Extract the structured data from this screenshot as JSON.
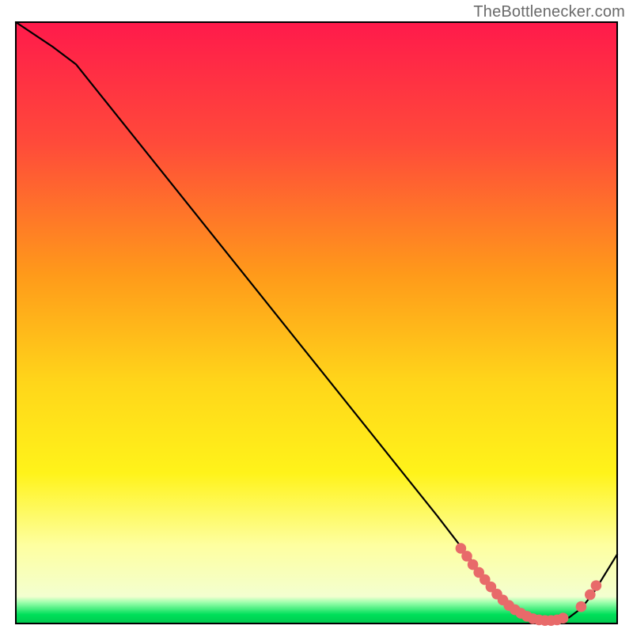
{
  "attribution": "TheBottlenecker.com",
  "chart_data": {
    "type": "line",
    "title": "",
    "xlabel": "",
    "ylabel": "",
    "xlim": [
      0,
      100
    ],
    "ylim": [
      0,
      100
    ],
    "background_gradient": {
      "top": "#ff1a4b",
      "mid_upper": "#ff8c1a",
      "mid": "#ffe31a",
      "mid_lower": "#f7ff7a",
      "green_band": "#00e05a",
      "green_band_range": [
        0,
        3
      ]
    },
    "series": [
      {
        "name": "bottleneck-curve",
        "x": [
          0,
          6,
          10,
          20,
          30,
          40,
          50,
          60,
          70,
          75,
          78,
          80,
          82,
          84,
          86,
          88,
          90,
          92,
          94,
          96,
          100
        ],
        "y": [
          100,
          96,
          93,
          80.5,
          68,
          55.5,
          43,
          30.5,
          18,
          11.5,
          7.5,
          5,
          3.5,
          2,
          1,
          0.5,
          0.5,
          1,
          2.5,
          5,
          11.5
        ]
      }
    ],
    "markers": {
      "name": "highlight-points",
      "color": "#e86a6a",
      "points": [
        {
          "x": 74,
          "y": 12.5
        },
        {
          "x": 75,
          "y": 11.2
        },
        {
          "x": 76,
          "y": 9.8
        },
        {
          "x": 77,
          "y": 8.5
        },
        {
          "x": 78,
          "y": 7.3
        },
        {
          "x": 79,
          "y": 6.1
        },
        {
          "x": 80,
          "y": 4.9
        },
        {
          "x": 81,
          "y": 3.9
        },
        {
          "x": 82,
          "y": 3.0
        },
        {
          "x": 83,
          "y": 2.3
        },
        {
          "x": 84,
          "y": 1.7
        },
        {
          "x": 85,
          "y": 1.2
        },
        {
          "x": 86,
          "y": 0.8
        },
        {
          "x": 87,
          "y": 0.6
        },
        {
          "x": 88,
          "y": 0.5
        },
        {
          "x": 89,
          "y": 0.5
        },
        {
          "x": 90,
          "y": 0.6
        },
        {
          "x": 91,
          "y": 0.9
        },
        {
          "x": 94,
          "y": 2.8
        },
        {
          "x": 95.5,
          "y": 4.8
        },
        {
          "x": 96.5,
          "y": 6.3
        }
      ]
    }
  }
}
